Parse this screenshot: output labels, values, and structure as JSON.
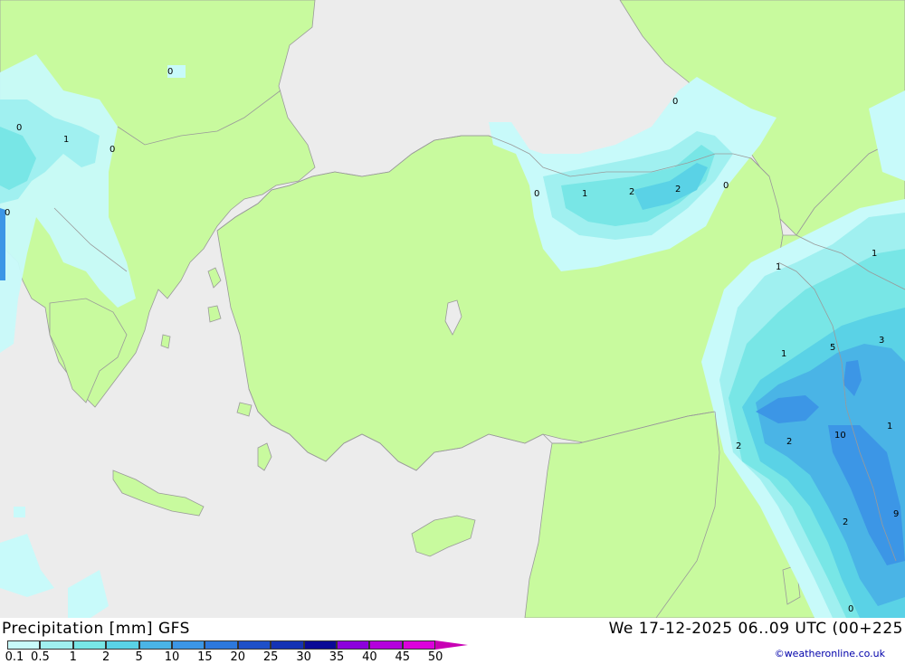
{
  "legend": {
    "title": "Precipitation [mm] GFS",
    "ticks": [
      "0.1",
      "0.5",
      "1",
      "2",
      "5",
      "10",
      "15",
      "20",
      "25",
      "30",
      "35",
      "40",
      "45",
      "50"
    ],
    "colors": [
      "#c8fafa",
      "#a0f0f0",
      "#78e6e6",
      "#5ad2e6",
      "#4ab4e6",
      "#3c96e6",
      "#2d78dc",
      "#1e50c8",
      "#1432b4",
      "#0a0a96",
      "#8c00dc",
      "#b400dc",
      "#dc00dc",
      "#c800b4"
    ]
  },
  "valid_time": "We 17-12-2025 06..09 UTC (00+225",
  "credit": "©weatheronline.co.uk",
  "map": {
    "land_color": "#c8fa9e",
    "sea_color": "#ececec",
    "contour_labels": [
      "0",
      "0",
      "1",
      "0",
      "0",
      "0",
      "1",
      "2",
      "2",
      "0",
      "0",
      "1",
      "1",
      "3",
      "5",
      "1",
      "1",
      "2",
      "2",
      "10",
      "9",
      "2",
      "0",
      "9"
    ]
  }
}
